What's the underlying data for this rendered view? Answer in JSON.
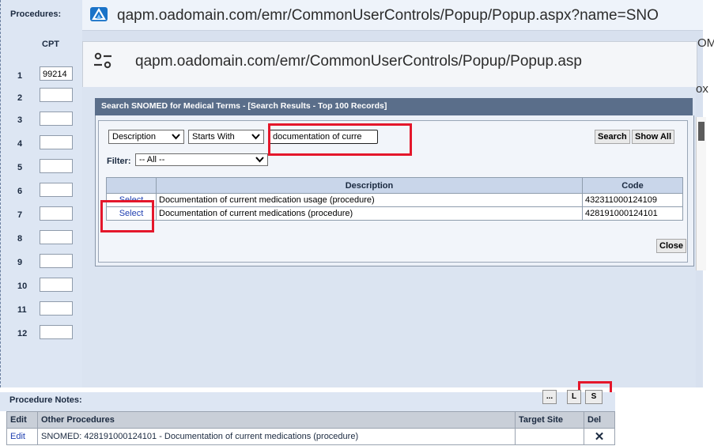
{
  "left_panel": {
    "title": "Procedures:",
    "cpt_header": "CPT",
    "rows": [
      {
        "num": "1",
        "value": "99214"
      },
      {
        "num": "2",
        "value": ""
      },
      {
        "num": "3",
        "value": ""
      },
      {
        "num": "4",
        "value": ""
      },
      {
        "num": "5",
        "value": ""
      },
      {
        "num": "6",
        "value": ""
      },
      {
        "num": "7",
        "value": ""
      },
      {
        "num": "8",
        "value": ""
      },
      {
        "num": "9",
        "value": ""
      },
      {
        "num": "10",
        "value": ""
      },
      {
        "num": "11",
        "value": ""
      },
      {
        "num": "12",
        "value": ""
      }
    ]
  },
  "browser_back": {
    "url": "qapm.oadomain.com/emr/CommonUserControls/Popup/Popup.aspx?name=SNO",
    "edge_fragment": "OM"
  },
  "browser_front": {
    "url": "qapm.oadomain.com/emr/CommonUserControls/Popup/Popup.asp",
    "edge_fragment": "ox"
  },
  "dialog": {
    "title": "Search SNOMED for Medical Terms - [Search Results - Top 100 Records]",
    "field_select": "Description",
    "match_select": "Starts With",
    "search_value": "documentation of curre",
    "search_button": "Search",
    "show_all_button": "Show All",
    "filter_label": "Filter:",
    "filter_value": "-- All --",
    "close_button": "Close",
    "results": {
      "headers": [
        "",
        "Description",
        "Code"
      ],
      "rows": [
        {
          "action": "Select",
          "description": "Documentation of current medication usage (procedure)",
          "code": "432311000124109"
        },
        {
          "action": "Select",
          "description": "Documentation of current medications (procedure)",
          "code": "428191000124101"
        }
      ]
    }
  },
  "notes": {
    "title": "Procedure Notes:",
    "buttons": [
      "...",
      "L",
      "S"
    ],
    "table": {
      "headers": [
        "Edit",
        "Other Procedures",
        "Target Site",
        "Del"
      ],
      "rows": [
        {
          "edit": "Edit",
          "procedure": "SNOMED: 428191000124101 - Documentation of current medications (procedure)",
          "target_site": "",
          "del": "✕"
        }
      ]
    }
  },
  "colors": {
    "highlight_red": "#e4172b",
    "header_blue": "#5a6e8a",
    "link_blue": "#1f3fb0"
  }
}
